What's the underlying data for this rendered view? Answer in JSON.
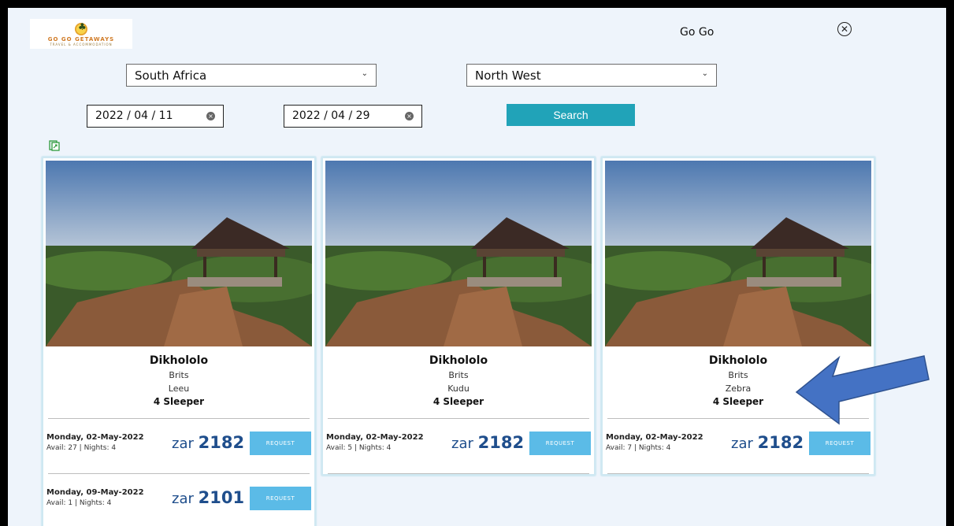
{
  "header": {
    "logo_text": "GO GO GETAWAYS",
    "logo_sub": "TRAVEL & ACCOMMODATION",
    "title": "Go Go"
  },
  "filters": {
    "country": "South Africa",
    "province": "North West",
    "date_from": "2022 / 04 / 11",
    "date_to": "2022 / 04 / 29",
    "search_label": "Search"
  },
  "cards": [
    {
      "name": "Dikhololo",
      "town": "Brits",
      "unit": "Leeu",
      "sleeper": "4 Sleeper",
      "rows": [
        {
          "date": "Monday, 02-May-2022",
          "avail": "Avail: 27  | Nights: 4",
          "currency": "zar",
          "price": "2182",
          "action": "REQUEST"
        },
        {
          "date": "Monday, 09-May-2022",
          "avail": "Avail: 1  | Nights: 4",
          "currency": "zar",
          "price": "2101",
          "action": "REQUEST"
        }
      ]
    },
    {
      "name": "Dikhololo",
      "town": "Brits",
      "unit": "Kudu",
      "sleeper": "4 Sleeper",
      "rows": [
        {
          "date": "Monday, 02-May-2022",
          "avail": "Avail: 5  | Nights: 4",
          "currency": "zar",
          "price": "2182",
          "action": "REQUEST"
        }
      ]
    },
    {
      "name": "Dikhololo",
      "town": "Brits",
      "unit": "Zebra",
      "sleeper": "4 Sleeper",
      "rows": [
        {
          "date": "Monday, 02-May-2022",
          "avail": "Avail: 7  | Nights: 4",
          "currency": "zar",
          "price": "2182",
          "action": "REQUEST"
        }
      ]
    }
  ],
  "colors": {
    "accent": "#21a3b8",
    "request": "#5bbbe7",
    "price": "#1f4e8c",
    "arrow": "#4472c4"
  },
  "icons": {
    "close": "close-circle-icon",
    "export": "export-icon",
    "dropdown": "chevron-down-icon",
    "clear": "clear-icon",
    "annotation": "arrow-icon"
  }
}
